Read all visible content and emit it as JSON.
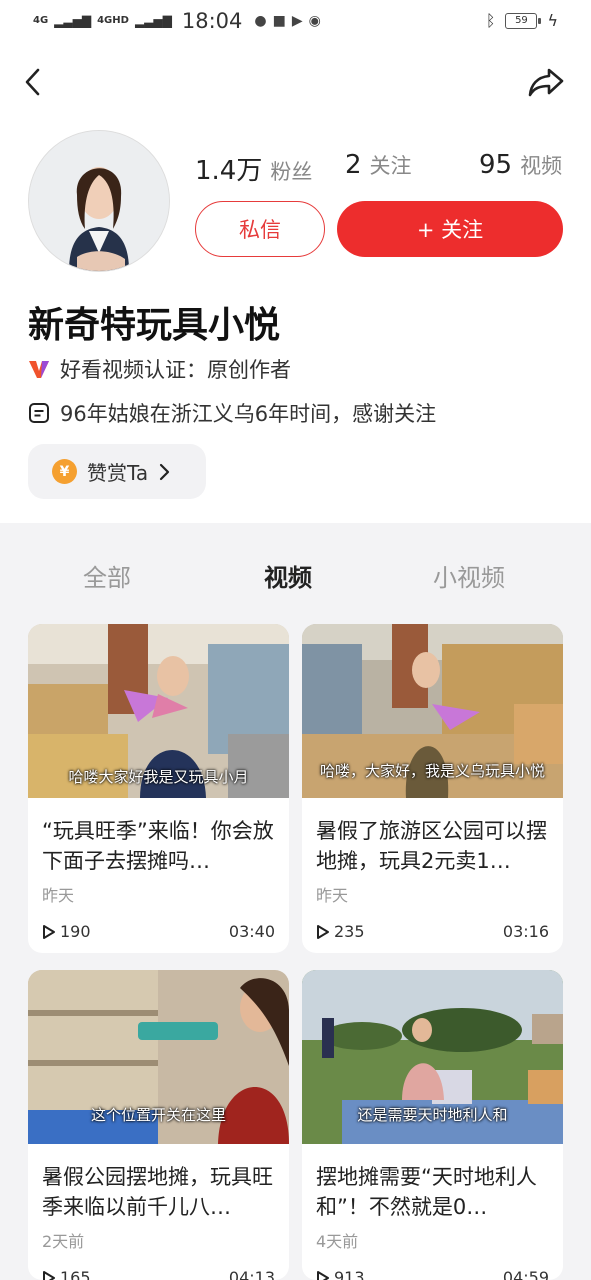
{
  "status_bar": {
    "signal1": "4G",
    "signal2": "4GHD",
    "time": "18:04",
    "battery": "59"
  },
  "profile": {
    "fans_count": "1.4万",
    "fans_label": "粉丝",
    "following_count": "2",
    "following_label": "关注",
    "videos_count": "95",
    "videos_label": "视频",
    "message_button": "私信",
    "follow_button": "+ 关注",
    "name": "新奇特玩具小悦",
    "certification": "好看视频认证：原创作者",
    "description": "96年姑娘在浙江义乌6年时间，感谢关注",
    "reward_label": "赞赏Ta",
    "reward_coin": "¥"
  },
  "tabs": [
    {
      "label": "全部"
    },
    {
      "label": "视频"
    },
    {
      "label": "小视频"
    }
  ],
  "videos": [
    {
      "caption": "哈喽大家好我是又玩具小月",
      "title": "“玩具旺季”来临！你会放下面子去摆摊吗…",
      "time": "昨天",
      "plays": "190",
      "duration": "03:40"
    },
    {
      "caption": "哈喽，大家好，我是义乌玩具小悦",
      "title": "暑假了旅游区公园可以摆地摊，玩具2元卖1…",
      "time": "昨天",
      "plays": "235",
      "duration": "03:16"
    },
    {
      "caption": "这个位置开关在这里",
      "title": "暑假公园摆地摊，玩具旺季来临以前千儿八…",
      "time": "2天前",
      "plays": "165",
      "duration": "04:13"
    },
    {
      "caption": "还是需要天时地利人和",
      "title": "摆地摊需要“天时地利人和”！不然就是0…",
      "time": "4天前",
      "plays": "913",
      "duration": "04:59"
    }
  ],
  "colors": {
    "accent": "#ed2d2d",
    "page_bg": "#f3f3f5"
  }
}
